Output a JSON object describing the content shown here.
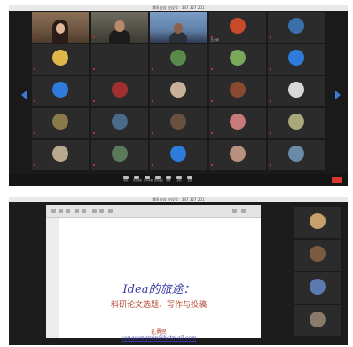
{
  "screenshot1": {
    "window_title": "腾讯会议  会议号：347 327 201",
    "participants": [
      {
        "name": "",
        "kind": "video-woman"
      },
      {
        "name": "",
        "kind": "video-man"
      },
      {
        "name": "",
        "kind": "video-man-outdoor"
      },
      {
        "name": "王小明",
        "avatar": "#c94a2a"
      },
      {
        "name": "",
        "avatar": "#3a6fa8"
      },
      {
        "name": "",
        "avatar": "#e0b84a"
      },
      {
        "name": "",
        "avatar": "#2a2a2a"
      },
      {
        "name": "",
        "avatar": "#5a8a4a"
      },
      {
        "name": "",
        "avatar": "#7aa85a"
      },
      {
        "name": "",
        "avatar": "#2d7cdc"
      },
      {
        "name": "",
        "avatar": "#2d7cdc"
      },
      {
        "name": "",
        "avatar": "#a03030"
      },
      {
        "name": "",
        "avatar": "#c8b09a"
      },
      {
        "name": "",
        "avatar": "#8a4a30"
      },
      {
        "name": "",
        "avatar": "#d8d8d8"
      },
      {
        "name": "",
        "avatar": "#8a7a4a"
      },
      {
        "name": "",
        "avatar": "#4a6a8a"
      },
      {
        "name": "",
        "avatar": "#6a5040"
      },
      {
        "name": "",
        "avatar": "#c87a7a"
      },
      {
        "name": "",
        "avatar": "#a8a87a"
      },
      {
        "name": "",
        "avatar": "#b8a890"
      },
      {
        "name": "",
        "avatar": "#5a7a5a"
      },
      {
        "name": "",
        "avatar": "#2d7cdc"
      },
      {
        "name": "",
        "avatar": "#b89080"
      },
      {
        "name": "",
        "avatar": "#6a8aa8"
      }
    ],
    "toolbar": [
      "静音",
      "开启视频",
      "共享屏幕",
      "管理成员",
      "聊天",
      "录制",
      "设置"
    ],
    "end_label": "结束会议"
  },
  "screenshot2": {
    "window_title": "腾讯会议  会议号：347 327 201",
    "slide": {
      "title": "Idea的旅途：",
      "subtitle": "科研论文选题、写作与投稿",
      "author": "孔勇民",
      "email": "kongdongmin@hotmail.com"
    },
    "side_tiles": [
      {
        "name": "",
        "color": "#c8a06a"
      },
      {
        "name": "",
        "color": "#7a5a40"
      },
      {
        "name": "",
        "color": "#5a7ab0"
      },
      {
        "name": "",
        "color": "#8a7a6a"
      }
    ]
  },
  "colors": {
    "accent": "#3a7bd5",
    "end": "#d9362f",
    "slide_title": "#3a3aa8",
    "slide_text": "#b2442e"
  }
}
